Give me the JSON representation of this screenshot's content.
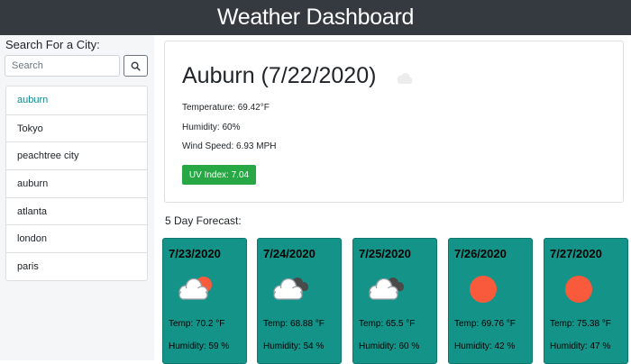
{
  "app": {
    "title": "Weather Dashboard"
  },
  "sidebar": {
    "search_title": "Search For a City:",
    "search_placeholder": "Search",
    "history": [
      "auburn",
      "Tokyo",
      "peachtree city",
      "auburn",
      "atlanta",
      "london",
      "paris"
    ]
  },
  "current": {
    "city_title": "Auburn (7/22/2020)",
    "icon": "cloud-icon",
    "temperature": "Temperature: 69.42°F",
    "humidity": "Humidity: 60%",
    "wind": "Wind Speed: 6.93 MPH",
    "uv": "UV Index: 7.04",
    "uv_color": "#28a745"
  },
  "forecast": {
    "heading": "5 Day Forecast:",
    "days": [
      {
        "date": "7/23/2020",
        "icon": "partly-cloudy-icon",
        "temp": "Temp: 70.2 °F",
        "humidity": "Humidity: 59 %"
      },
      {
        "date": "7/24/2020",
        "icon": "cloudy-icon",
        "temp": "Temp: 68.88 °F",
        "humidity": "Humidity: 54 %"
      },
      {
        "date": "7/25/2020",
        "icon": "cloudy-icon",
        "temp": "Temp: 65.5 °F",
        "humidity": "Humidity: 60 %"
      },
      {
        "date": "7/26/2020",
        "icon": "sun-icon",
        "temp": "Temp: 69.76 °F",
        "humidity": "Humidity: 42 %"
      },
      {
        "date": "7/27/2020",
        "icon": "sun-icon",
        "temp": "Temp: 75.38 °F",
        "humidity": "Humidity: 47 %"
      }
    ]
  },
  "colors": {
    "navbar": "#343a40",
    "card": "#149389",
    "sun": "#f95a3b",
    "uv_badge": "#28a745",
    "active_history": "#138a8a"
  }
}
